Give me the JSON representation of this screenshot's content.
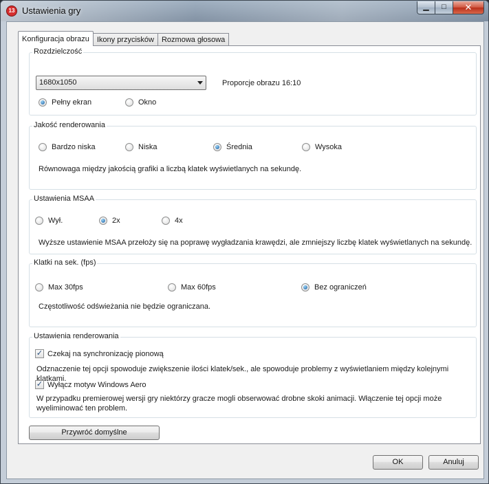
{
  "window": {
    "title": "Ustawienia gry",
    "app_icon_text": "13",
    "minimize_glyph": "▁",
    "maximize_glyph": "□",
    "close_glyph": "✕"
  },
  "tabs": [
    {
      "label": "Konfiguracja obrazu",
      "active": true
    },
    {
      "label": "Ikony przycisków",
      "active": false
    },
    {
      "label": "Rozmowa głosowa",
      "active": false
    }
  ],
  "resolution": {
    "title": "Rozdzielczość",
    "selected": "1680x1050",
    "aspect_label": "Proporcje obrazu 16:10",
    "options": [
      {
        "label": "Pełny ekran",
        "checked": true
      },
      {
        "label": "Okno",
        "checked": false
      }
    ]
  },
  "render_quality": {
    "title": "Jakość renderowania",
    "options": [
      {
        "label": "Bardzo niska",
        "checked": false
      },
      {
        "label": "Niska",
        "checked": false
      },
      {
        "label": "Średnia",
        "checked": true
      },
      {
        "label": "Wysoka",
        "checked": false
      }
    ],
    "description": "Równowaga między jakością grafiki a liczbą klatek wyświetlanych na sekundę."
  },
  "msaa": {
    "title": "Ustawienia MSAA",
    "options": [
      {
        "label": "Wył.",
        "checked": false
      },
      {
        "label": "2x",
        "checked": true
      },
      {
        "label": "4x",
        "checked": false
      }
    ],
    "description": "Wyższe ustawienie MSAA przełoży się na poprawę wygładzania krawędzi, ale zmniejszy liczbę klatek wyświetlanych na sekundę."
  },
  "fps": {
    "title": "Klatki na sek. (fps)",
    "options": [
      {
        "label": "Max 30fps",
        "checked": false
      },
      {
        "label": "Max 60fps",
        "checked": false
      },
      {
        "label": "Bez ograniczeń",
        "checked": true
      }
    ],
    "description": "Częstotliwość odświeżania nie będzie ograniczana."
  },
  "render_settings": {
    "title": "Ustawienia renderowania",
    "vsync": {
      "label": "Czekaj na synchronizację pionową",
      "checked": true,
      "description": "Odznaczenie tej opcji spowoduje zwiększenie ilości klatek/sek., ale spowoduje problemy z wyświetlaniem między kolejnymi klatkami."
    },
    "aero": {
      "label": "Wyłącz motyw Windows Aero",
      "checked": true,
      "description_line1": "W przypadku premierowej wersji gry niektórzy gracze mogli obserwować drobne skoki animacji. Włączenie tej opcji może",
      "description_line2": "wyeliminować ten problem."
    }
  },
  "buttons": {
    "restore_defaults": "Przywróć domyślne",
    "ok": "OK",
    "cancel": "Anuluj"
  },
  "check_glyph": "✓"
}
